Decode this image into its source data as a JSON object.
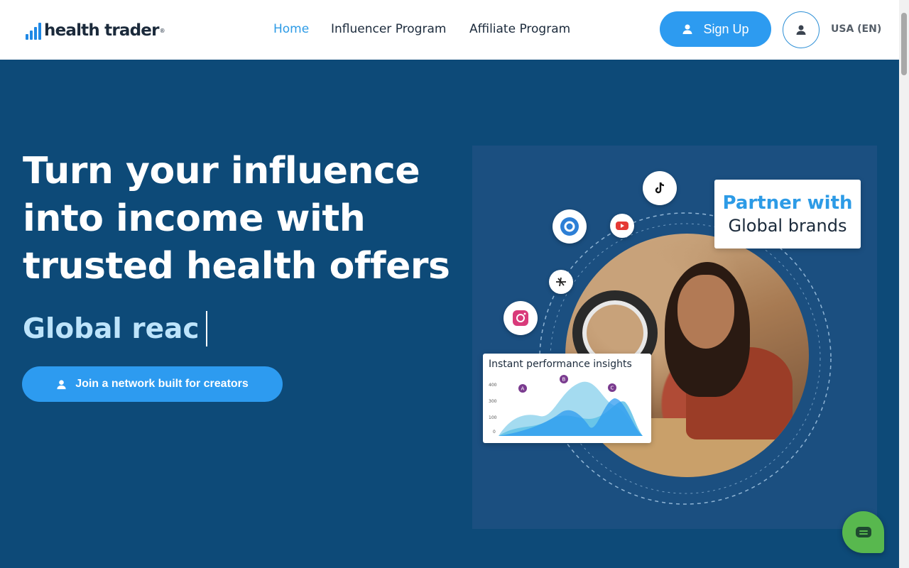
{
  "header": {
    "logo_text": "health trader",
    "nav": [
      {
        "label": "Home",
        "active": true
      },
      {
        "label": "Influencer Program",
        "active": false
      },
      {
        "label": "Affiliate Program",
        "active": false
      }
    ],
    "signup_label": "Sign Up",
    "locale_label": "USA (EN)"
  },
  "hero": {
    "title_lines": [
      "Turn your influence",
      "into income with",
      "trusted health offers"
    ],
    "typed_text": "Global reac",
    "cta_label": "Join a network built for creators"
  },
  "illustration": {
    "partner_line1": "Partner with",
    "partner_line2": "Global brands",
    "insights_title": "Instant performance insights",
    "insights_axis": [
      "400",
      "300",
      "100",
      "0"
    ],
    "insights_markers": [
      "A",
      "B",
      "C"
    ],
    "social_icons": [
      "tiktok-icon",
      "youtube-icon",
      "clubhouse-icon",
      "threads-icon",
      "instagram-icon"
    ]
  },
  "colors": {
    "brand_blue": "#2d9bf0",
    "hero_bg": "#0d4a78",
    "chat_green": "#58b84e"
  },
  "icons": {
    "user": "user-icon",
    "chat": "chat-icon"
  }
}
